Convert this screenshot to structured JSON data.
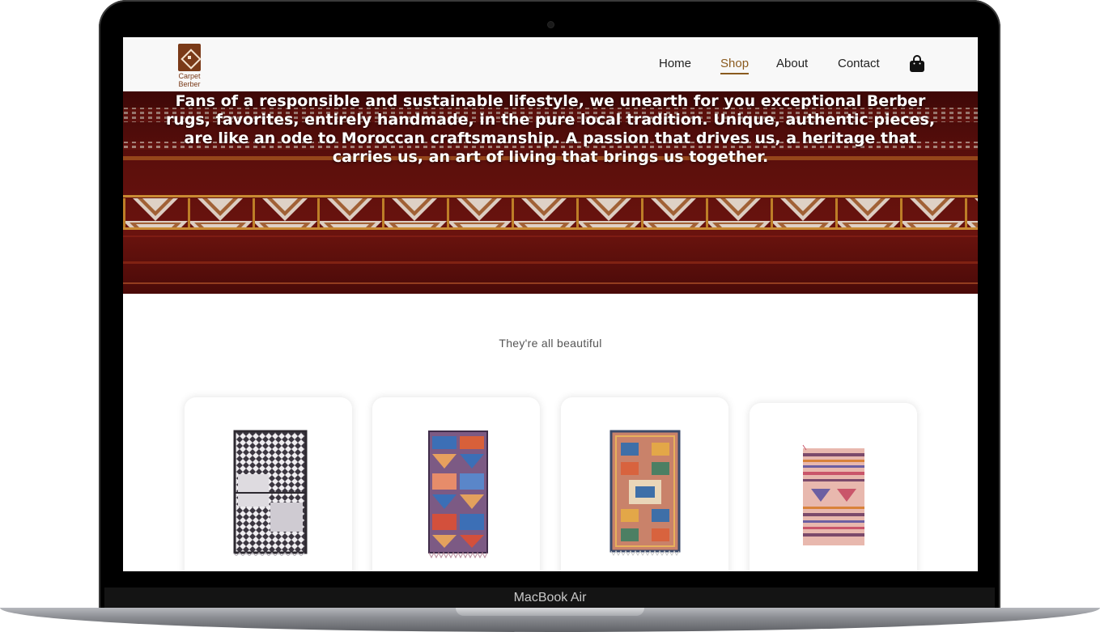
{
  "device": {
    "label": "MacBook Air"
  },
  "nav": {
    "logo_line1": "Carpet",
    "logo_line2": "Berber",
    "items": [
      {
        "label": "Home"
      },
      {
        "label": "Shop",
        "active": true
      },
      {
        "label": "About"
      },
      {
        "label": "Contact"
      }
    ],
    "cart_icon": "shopping-bag-icon",
    "accent_color": "#8a5a1e"
  },
  "hero": {
    "text": "Fans of a responsible and sustainable lifestyle, we unearth for you exceptional Berber rugs, favorites, entirely handmade, in the pure local tradition. Unique, authentic pieces, are like an ode to Moroccan craftsmanship. A passion that drives us, a heritage that carries us, an art of living that brings us together."
  },
  "products": {
    "title": "They're all beautiful",
    "items": [
      {
        "image": "black-white-berber-rug"
      },
      {
        "image": "colorful-kilim-rug"
      },
      {
        "image": "patterned-geometric-rug"
      },
      {
        "image": "striped-pink-kilim-rug"
      }
    ]
  }
}
